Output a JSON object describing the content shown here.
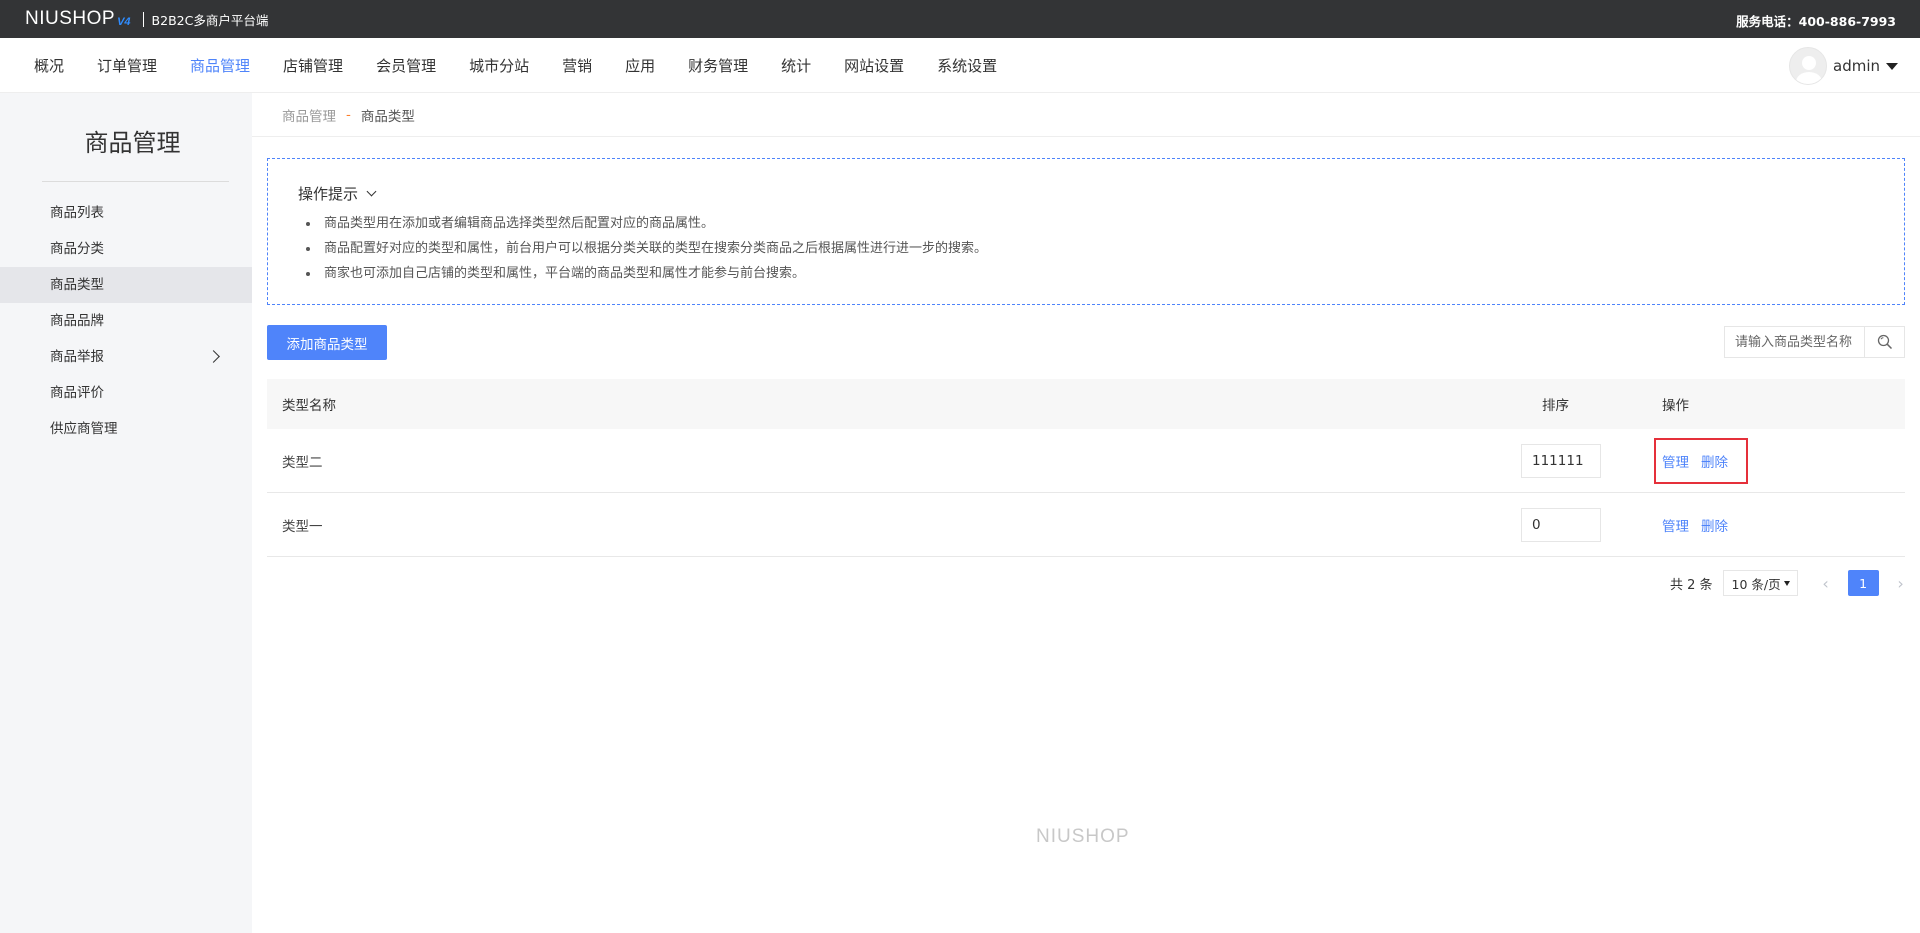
{
  "brand": {
    "logo": "NIUSHOP",
    "version": "V4",
    "subtitle": "B2B2C多商户平台端"
  },
  "service": "服务电话：400-886-7993",
  "nav": {
    "items": [
      "概况",
      "订单管理",
      "商品管理",
      "店铺管理",
      "会员管理",
      "城市分站",
      "营销",
      "应用",
      "财务管理",
      "统计",
      "网站设置",
      "系统设置"
    ],
    "active": "商品管理",
    "user": "admin"
  },
  "sidebar": {
    "title": "商品管理",
    "items": [
      "商品列表",
      "商品分类",
      "商品类型",
      "商品品牌",
      "商品举报",
      "商品评价",
      "供应商管理"
    ],
    "active": "商品类型"
  },
  "breadcrumb": {
    "parent": "商品管理",
    "separator": "-",
    "current": "商品类型"
  },
  "tips": {
    "title": "操作提示",
    "items": [
      "商品类型用在添加或者编辑商品选择类型然后配置对应的商品属性。",
      "商品配置好对应的类型和属性，前台用户可以根据分类关联的类型在搜索分类商品之后根据属性进行进一步的搜索。",
      "商家也可添加自己店铺的类型和属性，平台端的商品类型和属性才能参与前台搜索。"
    ]
  },
  "toolbar": {
    "add_label": "添加商品类型",
    "search_placeholder": "请输入商品类型名称"
  },
  "table": {
    "headers": {
      "name": "类型名称",
      "sort": "排序",
      "ops": "操作"
    },
    "rows": [
      {
        "name": "类型二",
        "sort": "111111",
        "manage": "管理",
        "delete": "删除"
      },
      {
        "name": "类型一",
        "sort": "0",
        "manage": "管理",
        "delete": "删除"
      }
    ]
  },
  "pager": {
    "total": "共 2 条",
    "page_size": "10 条/页",
    "current": "1"
  },
  "footer": {
    "logo": "NIUSHOP"
  },
  "colors": {
    "accent": "#4f84fa",
    "topbar": "#333436",
    "highlight_border": "#e5303a"
  }
}
